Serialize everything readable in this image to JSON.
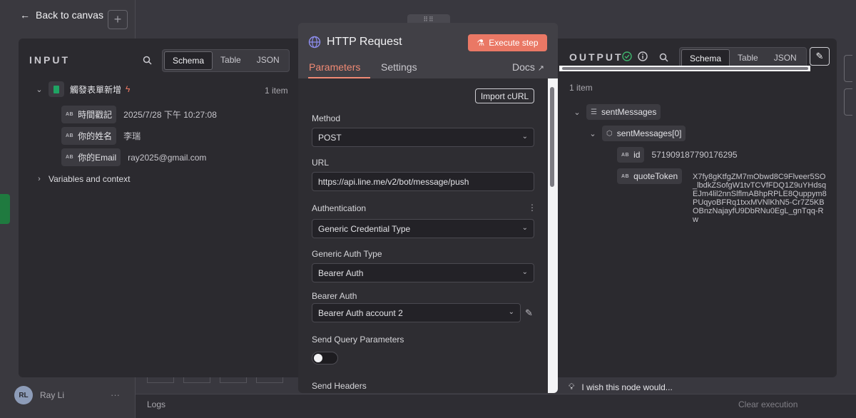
{
  "background": {
    "back_label": "Back to canvas",
    "add_glyph": "+",
    "user_initials": "RL",
    "user_name": "Ray Li",
    "more_glyph": "···",
    "logs_label": "Logs",
    "clear_label": "Clear execution"
  },
  "input": {
    "title": "INPUT",
    "views": [
      "Schema",
      "Table",
      "JSON"
    ],
    "active_view": "Schema",
    "node_name": "觸發表單新增",
    "item_count": "1 item",
    "fields": [
      {
        "key": "時間戳記",
        "value": "2025/7/28 下午 10:27:08"
      },
      {
        "key": "你的姓名",
        "value": "李瑞"
      },
      {
        "key": "你的Email",
        "value": "ray2025@gmail.com"
      }
    ],
    "variables_label": "Variables and context"
  },
  "node": {
    "handle": "⠿⠿",
    "title": "HTTP Request",
    "execute_label": "Execute step",
    "tabs": [
      "Parameters",
      "Settings"
    ],
    "active_tab": "Parameters",
    "docs_label": "Docs",
    "import_label": "Import cURL",
    "method_label": "Method",
    "method_value": "POST",
    "url_label": "URL",
    "url_value": "https://api.line.me/v2/bot/message/push",
    "auth_label": "Authentication",
    "auth_value": "Generic Credential Type",
    "generic_auth_label": "Generic Auth Type",
    "generic_auth_value": "Bearer Auth",
    "bearer_label": "Bearer Auth",
    "bearer_value": "Bearer Auth account 2",
    "send_query_label": "Send Query Parameters",
    "send_query_on": false,
    "send_headers_label": "Send Headers"
  },
  "output": {
    "title": "OUTPUT",
    "views": [
      "Schema",
      "Table",
      "JSON"
    ],
    "active_view": "Schema",
    "item_count": "1 item",
    "root_key": "sentMessages",
    "item_key": "sentMessages[0]",
    "id_key": "id",
    "id_value": "571909187790176295",
    "quote_key": "quoteToken",
    "quote_value": "X7fy8gKtfgZM7mObwd8C9Flveer5SO_lbdkZSofgW1tvTCVfFDQ1Z9uYHdsqEJm4lil2nnSlflmABhpRPLE8Quppym8PUqyoBFRq1txxMVNlKhN5-Cr7Z5KBOBnzNajayfU9DbRNu0EgL_gnTqq-Rw",
    "feedback_label": "I wish this node would..."
  },
  "colors": {
    "accent": "#ea7865",
    "tab_active": "#f08a74",
    "success": "#3fb56d"
  }
}
